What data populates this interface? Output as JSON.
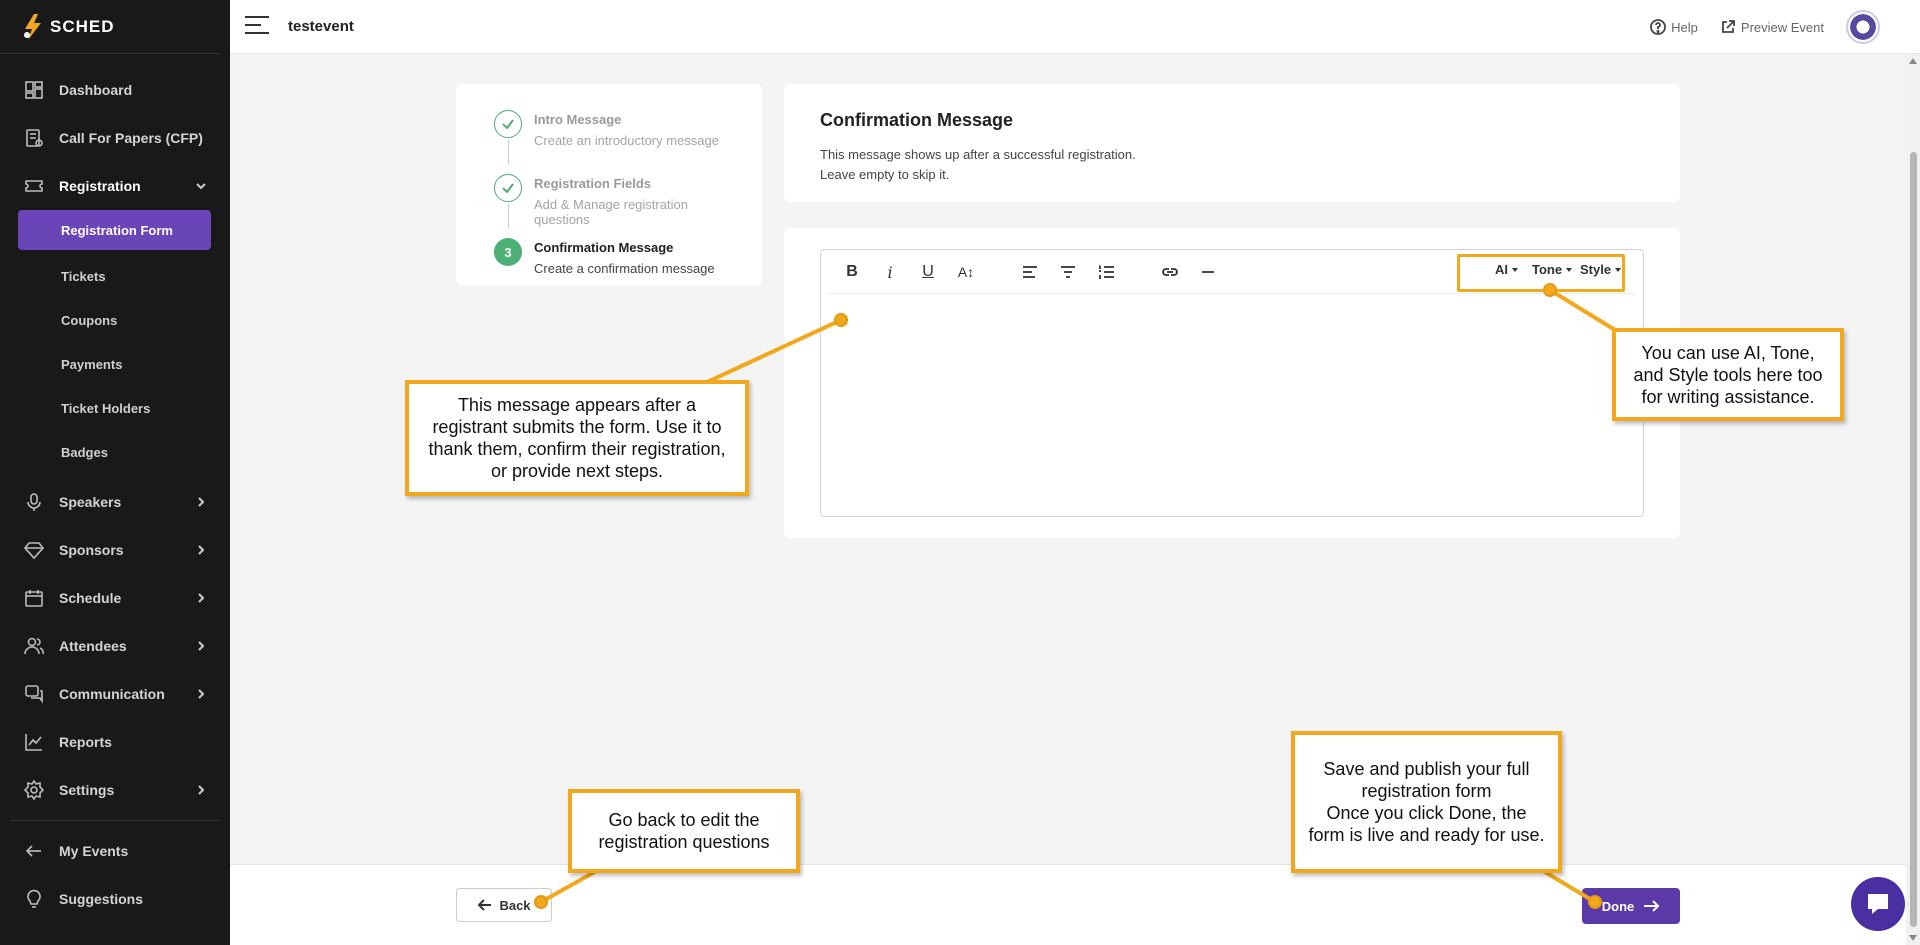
{
  "app": {
    "logo_text": "SCHED",
    "event_name": "testevent"
  },
  "sidebar": {
    "items": [
      {
        "label": "Dashboard",
        "icon": "dashboard-icon"
      },
      {
        "label": "Call For Papers (CFP)",
        "icon": "cfp-icon"
      },
      {
        "label": "Registration",
        "icon": "ticket-icon",
        "expanded": true
      }
    ],
    "sub_items": [
      "Registration Form",
      "Tickets",
      "Coupons",
      "Payments",
      "Ticket Holders",
      "Badges"
    ],
    "items2": [
      {
        "label": "Speakers",
        "icon": "microphone-icon"
      },
      {
        "label": "Sponsors",
        "icon": "diamond-icon"
      },
      {
        "label": "Schedule",
        "icon": "calendar-icon"
      },
      {
        "label": "Attendees",
        "icon": "users-icon"
      },
      {
        "label": "Communication",
        "icon": "chat-icon"
      },
      {
        "label": "Reports",
        "icon": "chart-icon"
      },
      {
        "label": "Settings",
        "icon": "gear-icon"
      }
    ],
    "footer": [
      {
        "label": "My Events",
        "icon": "arrow-left-icon"
      },
      {
        "label": "Suggestions",
        "icon": "lightbulb-icon"
      }
    ]
  },
  "topbar": {
    "help": "Help",
    "preview": "Preview Event"
  },
  "steps": [
    {
      "title": "Intro Message",
      "desc": "Create an introductory message"
    },
    {
      "title": "Registration Fields",
      "desc": "Add & Manage registration questions"
    },
    {
      "title": "Confirmation Message",
      "desc": "Create a confirmation message",
      "number": "3"
    }
  ],
  "confirmation": {
    "title": "Confirmation Message",
    "line1": "This message shows up after a successful registration.",
    "line2": "Leave empty to skip it."
  },
  "editor": {
    "tools": {
      "bold": "B",
      "italic": "i",
      "underline": "U",
      "font_size": "A↕"
    },
    "ai": "AI",
    "tone": "Tone",
    "style": "Style"
  },
  "footer_buttons": {
    "back": "Back",
    "done": "Done"
  },
  "annotations": {
    "editor_note": "This message appears after a registrant submits the form. Use it to thank them, confirm their registration, or provide next steps.",
    "ai_note": "You can use AI, Tone, and Style tools here too for writing assistance.",
    "back_note": "Go back to edit the registration questions",
    "done_note_1": "Save and publish your full registration form",
    "done_note_2": "Once you click Done, the form is live and ready for use."
  },
  "colors": {
    "accent": "#6a45b8",
    "success": "#4caf73",
    "callout": "#f2a81d"
  }
}
